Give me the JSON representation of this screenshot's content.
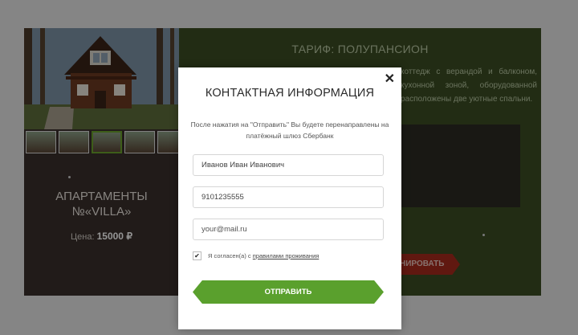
{
  "listing": {
    "title_line1": "АПАРТАМЕНТЫ",
    "title_line2": "№«VILLA»",
    "price_label": "Цена:",
    "price_value": "15000 ₽",
    "thumbnails": [
      "thumb-1",
      "thumb-2",
      "thumb-3",
      "thumb-4",
      "thumb-5"
    ],
    "active_thumbnail_index": 2
  },
  "tariff": {
    "heading": "ТАРИФ: ПОЛУПАНСИОН",
    "description_visible": "коттедж с верандой и балконом, кухонной зоной, оборудованной расположены две уютные спальни.",
    "book_button_visible": "НИРОВАТЬ"
  },
  "modal": {
    "title": "КОНТАКТНАЯ ИНФОРМАЦИЯ",
    "note": "После нажатия на \"Отправить\" Вы будете перенаправлены на платёжный шлюз Сбербанк",
    "name_placeholder": "Иванов Иван Иванович",
    "phone_placeholder": "9101235555",
    "email_placeholder": "your@mail.ru",
    "agree_checked": true,
    "agree_text": "Я согласен(а) с",
    "agree_link": "правилами проживания",
    "submit_label": "ОТПРАВИТЬ",
    "close_icon": "close-icon"
  },
  "colors": {
    "submit": "#5aa02d",
    "tariff_panel": "#3b4d24",
    "listing_panel": "#3a302b",
    "book_button": "#a52a1c"
  }
}
